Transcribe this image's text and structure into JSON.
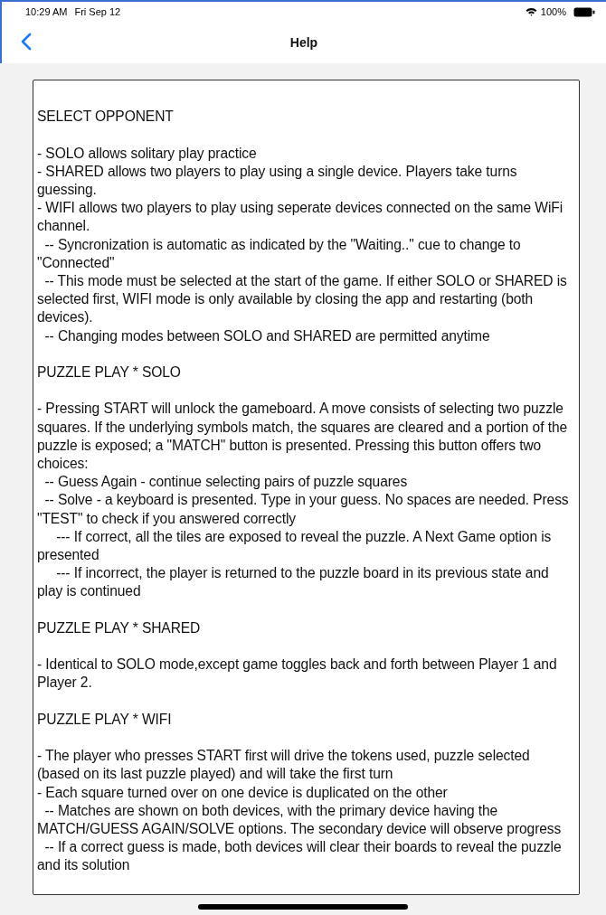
{
  "status_bar": {
    "time": "10:29 AM",
    "date": "Fri Sep 12",
    "battery": "100%"
  },
  "nav_bar": {
    "title": "Help"
  },
  "help_text": [
    {
      "kind": "heading",
      "text": "SELECT OPPONENT"
    },
    {
      "kind": "text",
      "text": "- SOLO allows solitary play practice"
    },
    {
      "kind": "text",
      "text": "- SHARED allows two players to play using a single device. Players take turns guessing."
    },
    {
      "kind": "text",
      "text": "- WIFI allows two players to play using seperate devices connected on the same WiFi channel."
    },
    {
      "kind": "text",
      "text": "  -- Syncronization is automatic as indicated by the \"Waiting..\" cue to change to \"Connected\""
    },
    {
      "kind": "text",
      "text": "  -- This mode must be selected at the start of the game. If either SOLO or SHARED is selected first, WIFI mode is only available by closing the app and restarting (both devices)."
    },
    {
      "kind": "text",
      "text": "  -- Changing modes between SOLO and SHARED are permitted anytime"
    },
    {
      "kind": "heading",
      "text": "PUZZLE PLAY * SOLO"
    },
    {
      "kind": "text",
      "text": "- Pressing START will unlock the gameboard. A move consists of selecting two puzzle squares. If the underlying symbols match, the squares are cleared and a portion of the puzzle is exposed; a \"MATCH\" button is presented. Pressing this button offers two choices:"
    },
    {
      "kind": "text",
      "text": "  -- Guess Again - continue selecting pairs of puzzle squares"
    },
    {
      "kind": "text",
      "text": "  -- Solve - a keyboard is presented. Type in your guess. No spaces are needed. Press \"TEST\" to check if you answered correctly"
    },
    {
      "kind": "text",
      "text": "     --- If correct, all the tiles are exposed to reveal the puzzle. A Next Game option is presented"
    },
    {
      "kind": "text",
      "text": "     --- If incorrect, the player is returned to the puzzle board in its previous state and play is continued"
    },
    {
      "kind": "heading",
      "text": "PUZZLE PLAY * SHARED"
    },
    {
      "kind": "text",
      "text": "- Identical to SOLO mode,except game toggles back and forth between Player 1 and Player 2."
    },
    {
      "kind": "heading",
      "text": "PUZZLE PLAY * WIFI"
    },
    {
      "kind": "text",
      "text": "- The player who presses START first will drive the tokens used, puzzle selected (based on its last puzzle played) and will take the first turn"
    },
    {
      "kind": "text",
      "text": "- Each square turned over on one device is duplicated on the other"
    },
    {
      "kind": "text",
      "text": "  -- Matches are shown on both devices, with the primary device having the MATCH/GUESS AGAIN/SOLVE options. The secondary device will observe progress"
    },
    {
      "kind": "text",
      "text": "  -- If a correct guess is made, both devices will clear their boards to reveal the puzzle and its solution"
    }
  ]
}
